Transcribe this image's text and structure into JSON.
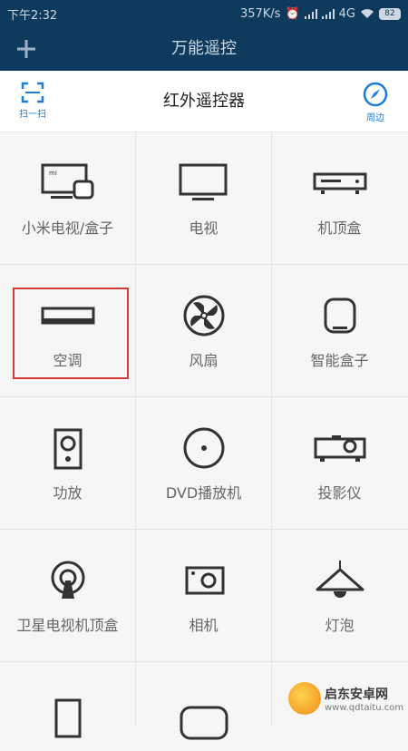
{
  "status_bar": {
    "time": "下午2:32",
    "net_speed": "357K/s",
    "network": "4G",
    "battery": "82"
  },
  "app_bar": {
    "add_icon": "plus-icon",
    "title": "万能遥控"
  },
  "sub_header": {
    "title": "红外遥控器",
    "scan_label": "扫一扫",
    "scan_icon": "scan-frame-icon",
    "nearby_label": "周边",
    "nearby_icon": "compass-icon",
    "accent_color": "#1a7ed8"
  },
  "devices": [
    {
      "label": "小米电视/盒子",
      "icon": "mi-tv-box-icon"
    },
    {
      "label": "电视",
      "icon": "tv-icon"
    },
    {
      "label": "机顶盒",
      "icon": "set-top-box-icon"
    },
    {
      "label": "空调",
      "icon": "air-conditioner-icon"
    },
    {
      "label": "风扇",
      "icon": "fan-icon"
    },
    {
      "label": "智能盒子",
      "icon": "smart-box-icon"
    },
    {
      "label": "功放",
      "icon": "amplifier-icon"
    },
    {
      "label": "DVD播放机",
      "icon": "dvd-icon"
    },
    {
      "label": "投影仪",
      "icon": "projector-icon"
    },
    {
      "label": "卫星电视机顶盒",
      "icon": "satellite-icon"
    },
    {
      "label": "相机",
      "icon": "camera-icon"
    },
    {
      "label": "灯泡",
      "icon": "lamp-icon"
    }
  ],
  "highlighted_device": "空调",
  "watermark": {
    "text": "启东安卓网",
    "url": "www.qdtaitu.com"
  }
}
